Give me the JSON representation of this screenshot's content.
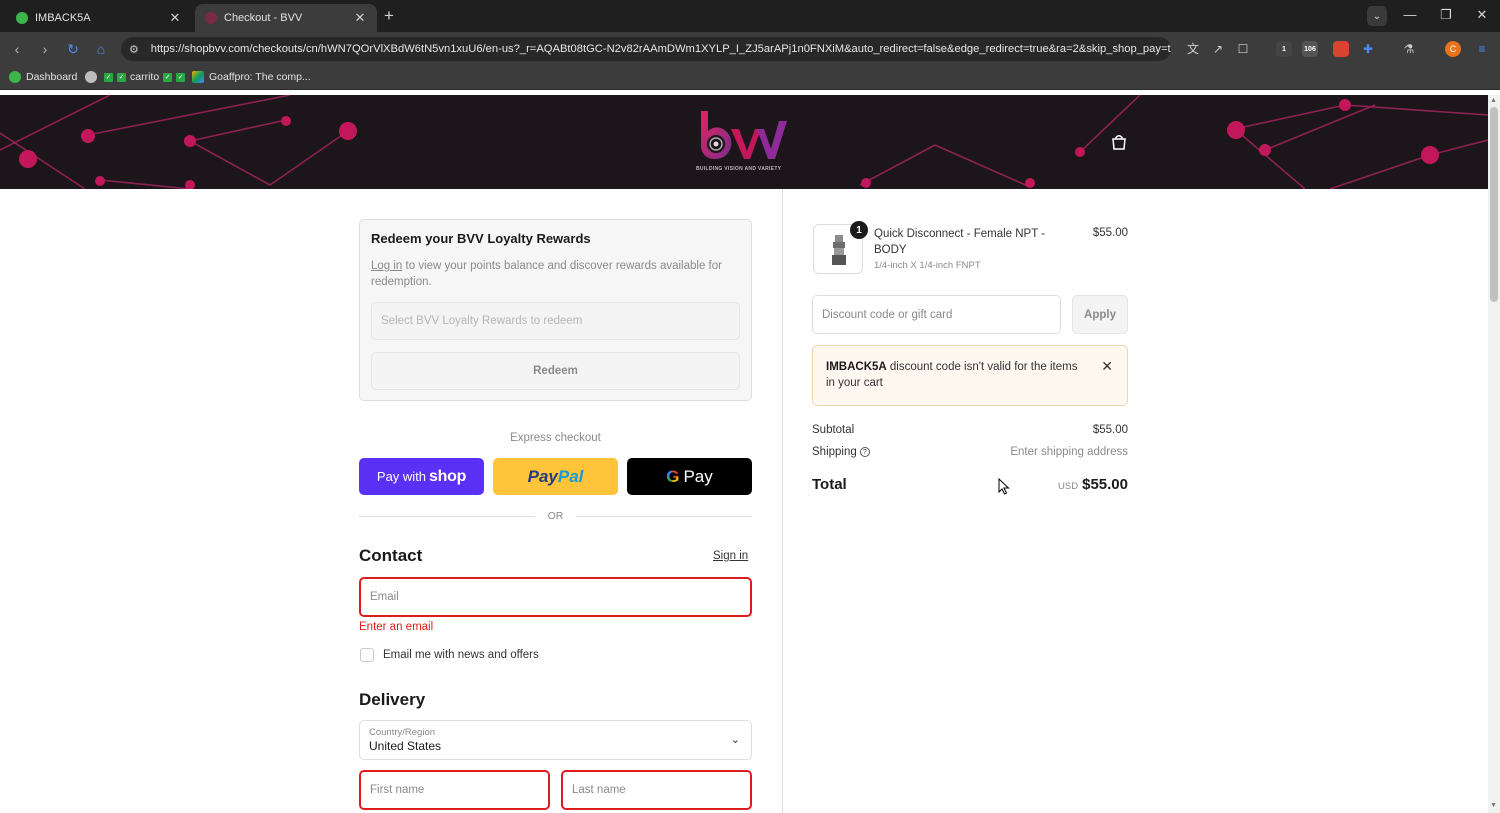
{
  "browser": {
    "tabs": [
      {
        "title": "IMBACK5A",
        "favicon_color": "#3cb54a"
      },
      {
        "title": "Checkout - BVV",
        "favicon_color": "#7a2a44"
      }
    ],
    "url": "https://shopbvv.com/checkouts/cn/hWN7QOrVlXBdW6tN5vn1xuU6/en-us?_r=AQABt08tGC-N2v82rAAmDWm1XYLP_I_ZJ5arAPj1n0FNXiM&auto_redirect=false&edge_redirect=true&ra=2&skip_shop_pay=true",
    "bookmarks": [
      "Dashboard",
      "carrito",
      "Goaffpro: The comp..."
    ],
    "extension_badges": [
      "1",
      "106"
    ],
    "profile_initial": "C"
  },
  "header": {
    "logo_tagline": "BUILDING VISION AND VARIETY"
  },
  "loyalty": {
    "title": "Redeem your BVV Loyalty Rewards",
    "login_link": "Log in",
    "description": " to view your points balance and discover rewards available for redemption.",
    "select_placeholder": "Select BVV Loyalty Rewards to redeem",
    "redeem_label": "Redeem"
  },
  "express": {
    "label": "Express checkout",
    "shop_pay_prefix": "Pay with",
    "shop_pay_brand": "shop",
    "paypal_label": "PayPal",
    "gpay_label": "Pay",
    "or_label": "OR"
  },
  "contact": {
    "title": "Contact",
    "signin_label": "Sign in",
    "email_placeholder": "Email",
    "email_error": "Enter an email",
    "newsletter_label": "Email me with news and offers"
  },
  "delivery": {
    "title": "Delivery",
    "country_label": "Country/Region",
    "country_value": "United States",
    "first_name_placeholder": "First name",
    "last_name_placeholder": "Last name"
  },
  "summary": {
    "product": {
      "quantity": "1",
      "name": "Quick Disconnect - Female NPT - BODY",
      "variant": "1/4-inch X 1/4-inch FNPT",
      "price": "$55.00"
    },
    "discount_placeholder": "Discount code or gift card",
    "apply_label": "Apply",
    "alert": {
      "code": "IMBACK5A",
      "message": " discount code isn't valid for the items in your cart"
    },
    "subtotal_label": "Subtotal",
    "subtotal_value": "$55.00",
    "shipping_label": "Shipping",
    "shipping_value": "Enter shipping address",
    "total_label": "Total",
    "total_currency": "USD",
    "total_value": "$55.00"
  },
  "colors": {
    "shop_pay": "#5a31f4",
    "paypal": "#ffc439",
    "error": "#dd1d1d",
    "brand_magenta": "#c2185b"
  }
}
